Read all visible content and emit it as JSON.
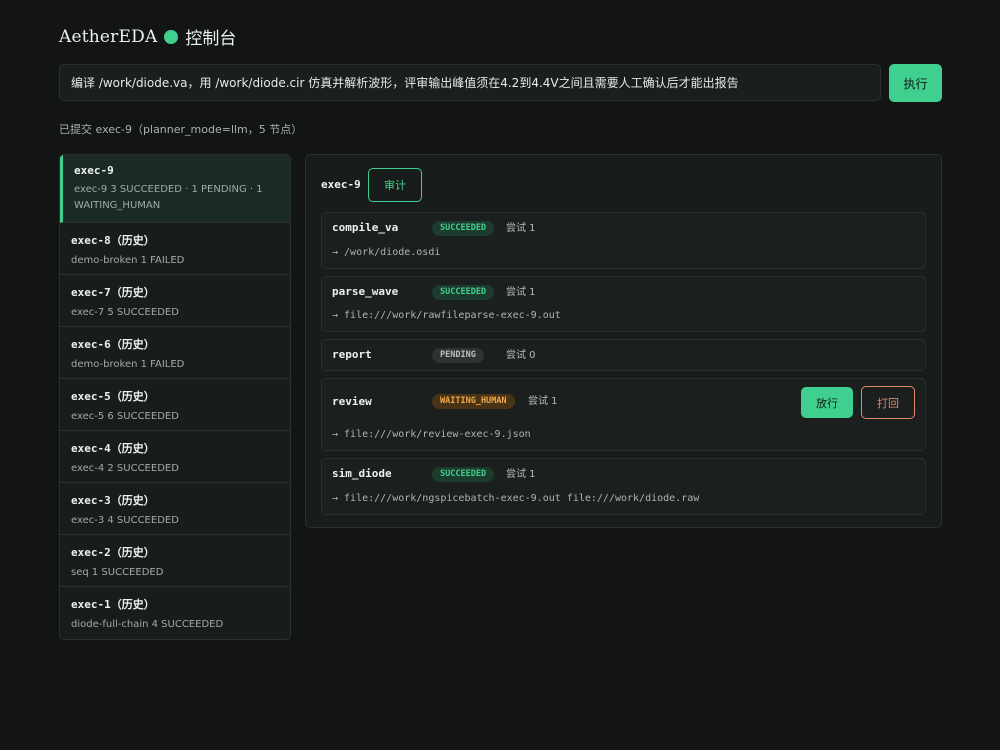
{
  "header": {
    "brand": "AetherEDA",
    "title": "控制台",
    "accent_color": "#3fcf8e"
  },
  "command": {
    "value": "编译 /work/diode.va，用 /work/diode.cir 仿真并解析波形，评审输出峰值须在4.2到4.4V之间且需要人工确认后才能出报告",
    "run_label": "执行"
  },
  "submit_status": "已提交 exec-9（planner_mode=llm，5 节点）",
  "executions": [
    {
      "name": "exec-9",
      "summary": "exec-9 3 SUCCEEDED · 1 PENDING · 1 WAITING_HUMAN"
    },
    {
      "name": "exec-8（历史）",
      "summary": "demo-broken 1 FAILED"
    },
    {
      "name": "exec-7（历史）",
      "summary": "exec-7 5 SUCCEEDED"
    },
    {
      "name": "exec-6（历史）",
      "summary": "demo-broken 1 FAILED"
    },
    {
      "name": "exec-5（历史）",
      "summary": "exec-5 6 SUCCEEDED"
    },
    {
      "name": "exec-4（历史）",
      "summary": "exec-4 2 SUCCEEDED"
    },
    {
      "name": "exec-3（历史）",
      "summary": "exec-3 4 SUCCEEDED"
    },
    {
      "name": "exec-2（历史）",
      "summary": "seq 1 SUCCEEDED"
    },
    {
      "name": "exec-1（历史）",
      "summary": "diode-full-chain 4 SUCCEEDED"
    }
  ],
  "detail": {
    "title": "exec-9",
    "audit_label": "审计",
    "nodes": [
      {
        "name": "compile_va",
        "status": "SUCCEEDED",
        "attempt": "尝试 1",
        "output": "→ /work/diode.osdi"
      },
      {
        "name": "parse_wave",
        "status": "SUCCEEDED",
        "attempt": "尝试 1",
        "output": "→ file:///work/rawfileparse-exec-9.out"
      },
      {
        "name": "report",
        "status": "PENDING",
        "attempt": "尝试 0",
        "output": ""
      },
      {
        "name": "review",
        "status": "WAITING_HUMAN",
        "attempt": "尝试 1",
        "output": "→ file:///work/review-exec-9.json",
        "release_label": "放行",
        "reject_label": "打回"
      },
      {
        "name": "sim_diode",
        "status": "SUCCEEDED",
        "attempt": "尝试 1",
        "output": "→ file:///work/ngspicebatch-exec-9.out file:///work/diode.raw"
      }
    ]
  }
}
